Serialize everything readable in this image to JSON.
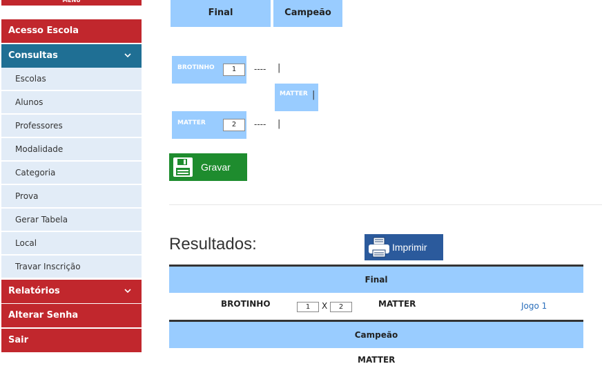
{
  "sidebar": {
    "header": "MENU",
    "acesso_escola": "Acesso Escola",
    "consultas": "Consultas",
    "consultas_items": [
      "Escolas",
      "Alunos",
      "Professores",
      "Modalidade",
      "Categoria",
      "Prova",
      "Gerar Tabela",
      "Local",
      "Travar Inscrição"
    ],
    "relatorios": "Relatórios",
    "alterar_senha": "Alterar Senha",
    "sair": "Sair"
  },
  "tabs": {
    "final": "Final",
    "campeao": "Campeão"
  },
  "bracket": {
    "team1": {
      "name": "BROTINHO",
      "score": "1"
    },
    "team2": {
      "name": "MATTER",
      "score": "2"
    },
    "dash": "----",
    "pipe": "|",
    "winner": "MATTER"
  },
  "buttons": {
    "gravar": "Gravar",
    "imprimir": "Imprimir"
  },
  "results": {
    "title": "Resultados:",
    "final_header": "Final",
    "match": {
      "home": "BROTINHO",
      "home_score": "1",
      "sep": "X",
      "away_score": "2",
      "away": "MATTER",
      "link": "Jogo 1"
    },
    "campeao_header": "Campeão",
    "champion": "MATTER"
  },
  "colors": {
    "menu_red": "#c1272d",
    "menu_teal": "#1f6f94",
    "light_blue": "#99ccff",
    "green": "#1e8c2e",
    "print_blue": "#2b5a9c"
  }
}
